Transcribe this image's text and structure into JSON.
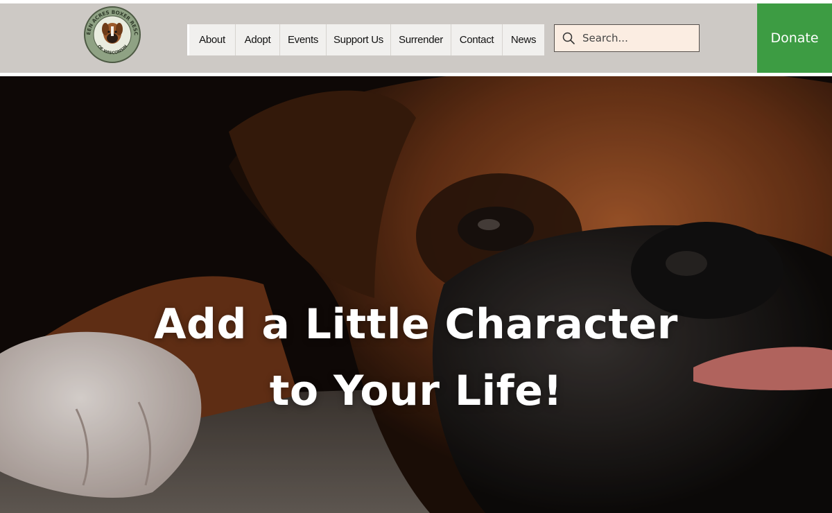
{
  "header": {
    "logo": {
      "text_top": "GREEN ACRES BOXER RESCUE",
      "text_bottom": "OF WISCONSIN"
    },
    "nav": [
      {
        "label": "About"
      },
      {
        "label": "Adopt"
      },
      {
        "label": "Events"
      },
      {
        "label": "Support Us"
      },
      {
        "label": "Surrender"
      },
      {
        "label": "Contact"
      },
      {
        "label": "News"
      }
    ],
    "search": {
      "placeholder": "Search...",
      "value": "",
      "icon": "search-icon"
    },
    "donate_label": "Donate"
  },
  "hero": {
    "line1": "Add a Little Character",
    "line2": "to Your Life!"
  },
  "colors": {
    "header_bg": "#cdc9c5",
    "nav_bg": "#f1f0ee",
    "search_bg": "#fbede2",
    "donate_bg": "#3d9c43",
    "heading_text": "#ffffff"
  }
}
